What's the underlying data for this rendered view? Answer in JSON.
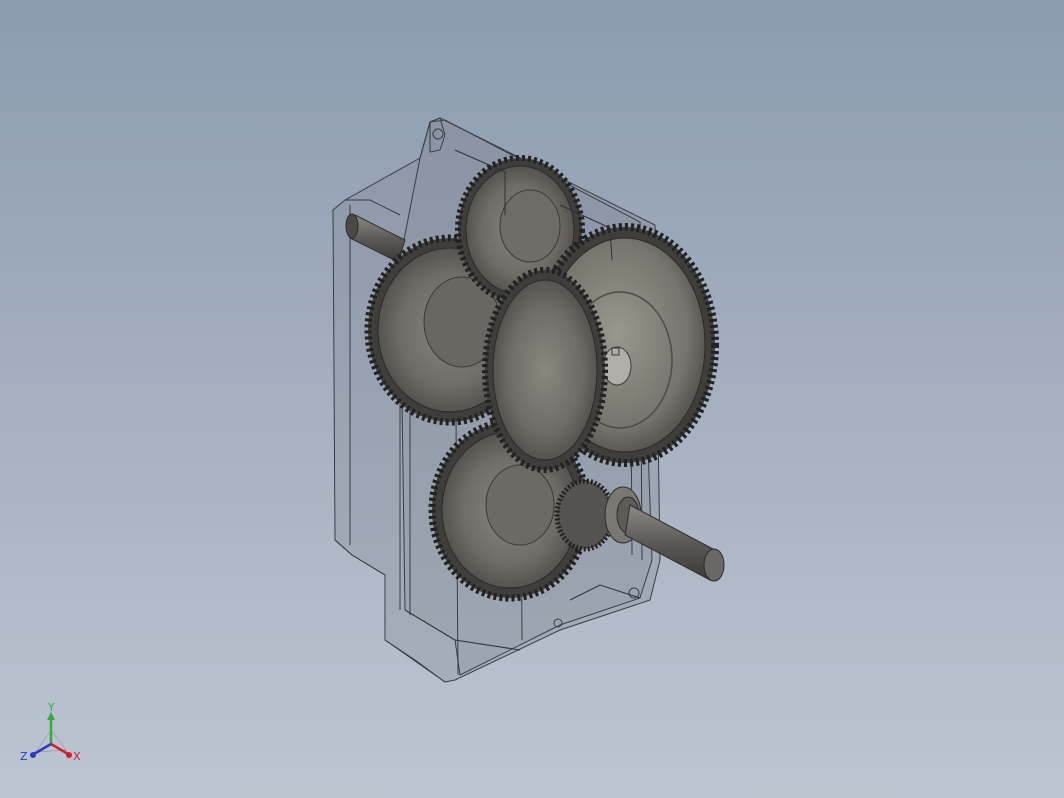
{
  "viewport": {
    "background_top": "#8c9bb0",
    "background_bottom": "#bdc5d1"
  },
  "model": {
    "icon": "gearbox-assembly"
  },
  "triad": {
    "x_label": "X",
    "y_label": "Y",
    "z_label": "Z",
    "x_color": "#d0202a",
    "y_color": "#2fae3b",
    "z_color": "#2b3bc4"
  }
}
